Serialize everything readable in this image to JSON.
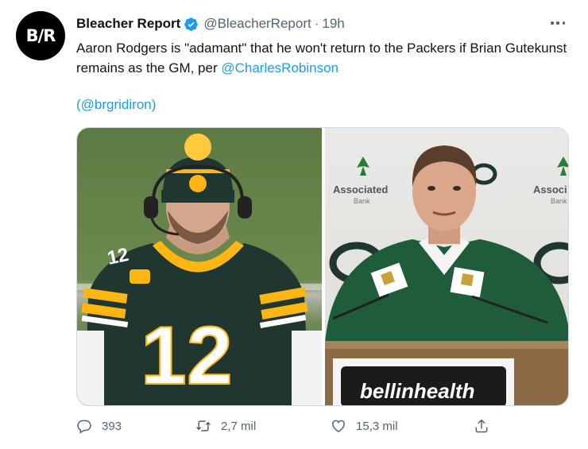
{
  "author": {
    "avatar_text": "B/R",
    "display_name": "Bleacher Report",
    "handle": "@BleacherReport",
    "separator": "·",
    "time": "19h",
    "verified": true
  },
  "tweet": {
    "text_before": "Aaron Rodgers is \"adamant\" that he won't return to the Packers if Brian Gutekunst remains as the GM, per ",
    "mention": "@CharlesRobinson",
    "handle_credit": "(@brgridiron)"
  },
  "media": {
    "left_jersey_number": "12",
    "right_sponsor_logo": "Associated",
    "right_sponsor_sub": "Bank",
    "right_sponsor_logo_2": "Associ",
    "right_sponsor_sub_2": "Bank",
    "podium_text": "bellinhealth"
  },
  "actions": {
    "reply_count": "393",
    "retweet_count": "2,7 mil",
    "like_count": "15,3 mil"
  },
  "colors": {
    "accent": "#1d9bf0",
    "text_secondary": "#536471",
    "packers_green": "#203731",
    "packers_gold": "#ffb612"
  },
  "icons": [
    "verified-icon",
    "more-icon",
    "reply-icon",
    "retweet-icon",
    "like-icon",
    "share-icon"
  ]
}
